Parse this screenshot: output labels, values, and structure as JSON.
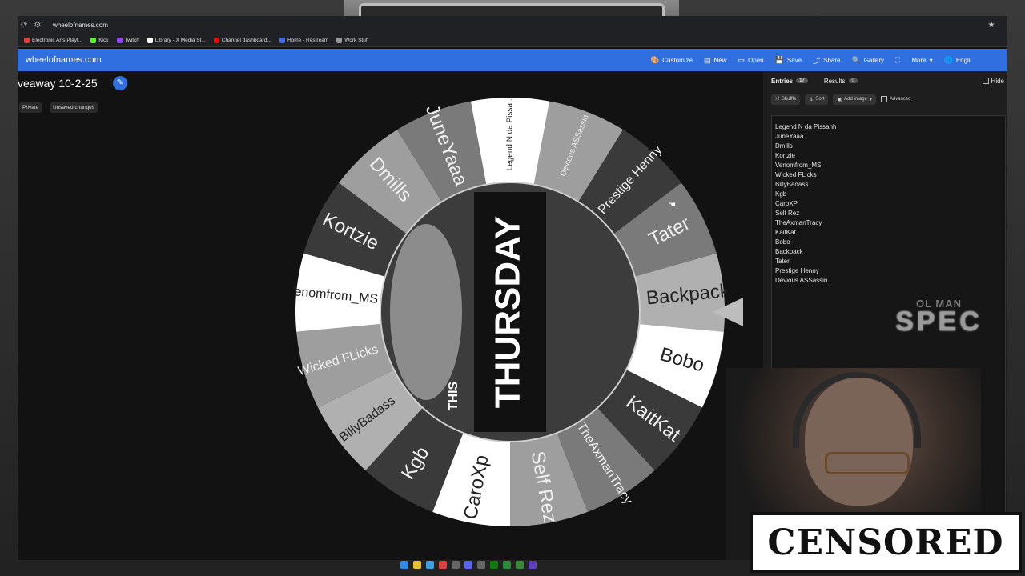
{
  "browser": {
    "url": "wheelofnames.com",
    "bookmarks": [
      {
        "label": "Electronic Arts Playt...",
        "color": "#e04040"
      },
      {
        "label": "Kick",
        "color": "#53fc18"
      },
      {
        "label": "Twitch",
        "color": "#9146ff"
      },
      {
        "label": "Library - X Media St...",
        "color": "#ffffff"
      },
      {
        "label": "Channel dashboard...",
        "color": "#ff0000"
      },
      {
        "label": "Home - Restream",
        "color": "#3b6cff"
      },
      {
        "label": "Work Stuff",
        "color": "#999999"
      }
    ]
  },
  "app": {
    "site": "wheelofnames.com",
    "menu": [
      "Customize",
      "New",
      "Open",
      "Save",
      "Share",
      "Gallery",
      "More",
      "Engli"
    ],
    "title": "veaway 10-2-25",
    "chips": [
      "Private",
      "Unsaved changes"
    ],
    "accent": "#2f6fe0"
  },
  "panel": {
    "tab_entries": "Entries",
    "entries_count": "17",
    "tab_results": "Results",
    "results_count": "0",
    "hide_label": "Hide",
    "tools": [
      "Shuffle",
      "Sort",
      "Add image",
      "Advanced"
    ],
    "entries": [
      "Legend N da Pissahh",
      "JuneYaaa",
      "Dmills",
      "Kortzie",
      "Venomfrom_MS",
      "Wicked FLicks",
      "BillyBadass",
      "Kgb",
      "CaroXP",
      "Self Rez",
      "TheAxmanTracy",
      "KaitKat",
      "Bobo",
      "Backpack",
      "Tater",
      "Prestige Henny",
      "Devious ASSassin"
    ]
  },
  "wheel": {
    "slices": [
      "Legend N da Pissa...",
      "Devious ASSassin",
      "Prestige Henny",
      "Tater",
      "Backpack",
      "Bobo",
      "KaitKat",
      "TheAxmanTracy",
      "Self Rez",
      "CaroXp",
      "Kgb",
      "BillyBadass",
      "Wicked FLicks",
      "Venomfrom_MS",
      "Kortzie",
      "Dmills",
      "JuneYaaa"
    ],
    "center_text": "THURSDAY",
    "center_small": "THIS",
    "colors": [
      "#ffffff",
      "#9e9e9e",
      "#3a3a3a",
      "#7a7a7a",
      "#b0b0b0",
      "#ffffff",
      "#3a3a3a",
      "#7a7a7a",
      "#9e9e9e",
      "#ffffff",
      "#3a3a3a",
      "#b0b0b0",
      "#9e9e9e",
      "#ffffff",
      "#3a3a3a",
      "#9e9e9e",
      "#7a7a7a"
    ]
  },
  "overlay": {
    "watermark_top": "OL MAN",
    "watermark_big": "SPEC",
    "censor": "CENSORED"
  }
}
